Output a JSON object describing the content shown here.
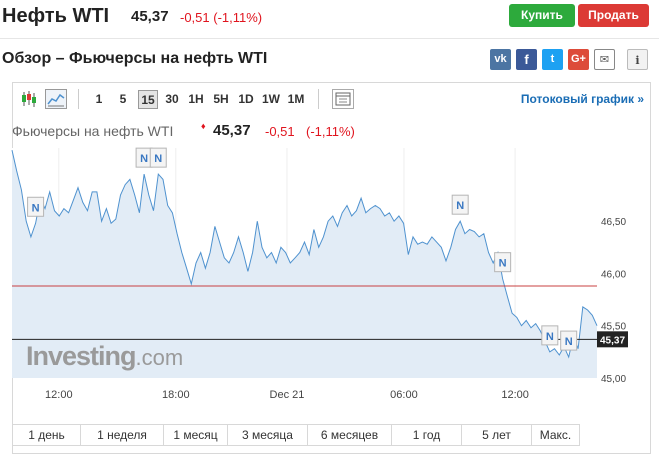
{
  "header": {
    "title": "Нефть WTI",
    "price": "45,37",
    "change": "-0,51 (-1,11%)",
    "buy_label": "Купить",
    "sell_label": "Продать"
  },
  "subheader": {
    "title": "Обзор – Фьючерсы на нефть WTI"
  },
  "social": {
    "vk": "vk",
    "fb": "f",
    "tw": "t",
    "gp": "G+",
    "mail": "✉",
    "info": "i"
  },
  "toolbar": {
    "timeframes": [
      "1",
      "5",
      "15",
      "30",
      "1H",
      "5H",
      "1D",
      "1W",
      "1M"
    ],
    "active_timeframe": "15",
    "stream_label": "Потоковый график »"
  },
  "chart_title": {
    "name": "Фьючерсы на нефть WTI",
    "marker": "♦",
    "price": "45,37",
    "change": "-0,51",
    "change_pct": "(-1,11%)"
  },
  "chart_data": {
    "type": "area",
    "x_tick_labels": [
      "12:00",
      "18:00",
      "Dec 21",
      "06:00",
      "12:00"
    ],
    "x_tick_positions": [
      0.08,
      0.28,
      0.47,
      0.67,
      0.86
    ],
    "y_tick_labels": [
      "46,50",
      "46,00",
      "45,50",
      "45,00"
    ],
    "ylim": [
      45.0,
      47.2
    ],
    "y_ticks": [
      46.5,
      46.0,
      45.5,
      45.0
    ],
    "series": [
      {
        "values": [
          47.18,
          46.98,
          46.8,
          46.5,
          46.35,
          46.48,
          46.72,
          46.62,
          46.78,
          46.6,
          46.55,
          46.62,
          46.58,
          46.7,
          46.82,
          46.68,
          46.6,
          46.78,
          46.78,
          46.5,
          46.62,
          46.48,
          46.52,
          46.75,
          46.85,
          46.9,
          46.75,
          46.58,
          46.95,
          46.75,
          46.6,
          46.95,
          46.9,
          46.65,
          46.58,
          46.38,
          46.2,
          46.05,
          45.9,
          46.1,
          46.2,
          46.05,
          46.2,
          46.45,
          46.3,
          46.15,
          46.1,
          46.2,
          46.35,
          46.2,
          46.02,
          46.2,
          46.5,
          46.25,
          46.15,
          46.2,
          46.1,
          46.25,
          46.2,
          46.1,
          46.15,
          46.2,
          46.3,
          46.18,
          46.42,
          46.25,
          46.35,
          46.5,
          46.55,
          46.45,
          46.58,
          46.65,
          46.55,
          46.6,
          46.72,
          46.58,
          46.62,
          46.65,
          46.62,
          46.55,
          46.58,
          46.5,
          46.55,
          46.48,
          46.18,
          46.35,
          46.28,
          46.3,
          46.28,
          46.35,
          46.3,
          46.25,
          46.12,
          46.25,
          46.42,
          46.5,
          46.38,
          46.42,
          46.4,
          46.35,
          46.38,
          46.2,
          46.1,
          46.2,
          45.95,
          45.78,
          45.62,
          45.58,
          45.5,
          45.55,
          45.48,
          45.52,
          45.45,
          45.35,
          45.25,
          45.28,
          45.22,
          45.3,
          45.2,
          45.4,
          45.28,
          45.68,
          45.65,
          45.6,
          45.5
        ],
        "color": "#4f92cf",
        "fill": "#e2ecf6"
      }
    ],
    "reference_lines": [
      {
        "value": 45.88,
        "color": "#c84141"
      },
      {
        "value": 45.37,
        "color": "#222222",
        "label": "45,37"
      }
    ],
    "news_markers": [
      {
        "label": "N",
        "index": 5
      },
      {
        "label": "N",
        "index": 28
      },
      {
        "label": "N",
        "index": 31
      },
      {
        "label": "N",
        "index": 95
      },
      {
        "label": "N",
        "index": 104
      },
      {
        "label": "N",
        "index": 114
      },
      {
        "label": "N",
        "index": 118
      }
    ],
    "grid": "vertical"
  },
  "watermark": {
    "brand": "Investing",
    "suffix": ".com"
  },
  "ranges": [
    "1 день",
    "1 неделя",
    "1 месяц",
    "3 месяца",
    "6 месяцев",
    "1 год",
    "5 лет",
    "Макс."
  ]
}
